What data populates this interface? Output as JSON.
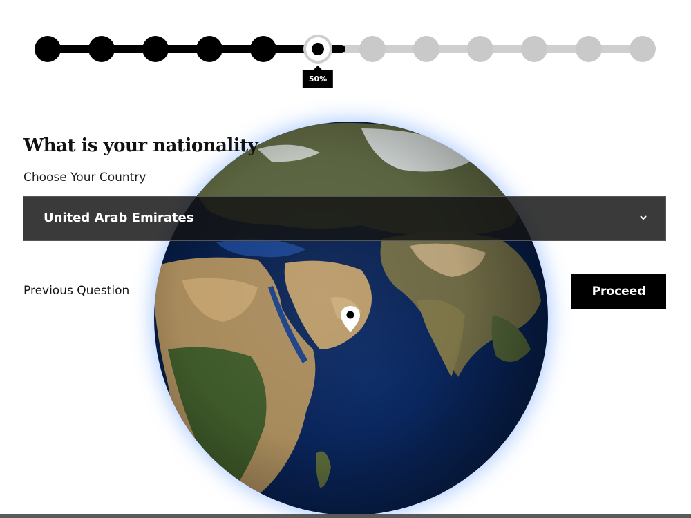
{
  "progress": {
    "percent_label": "50%",
    "percent": 50,
    "total_steps": 12,
    "completed_steps": 5,
    "current_step": 6,
    "colors": {
      "done": "#000000",
      "pending": "#c9c9c9",
      "badge": "#000000"
    }
  },
  "question": {
    "title": "What is your nationality",
    "subtitle": "Choose Your Country"
  },
  "country_select": {
    "selected_value": "United Arab Emirates",
    "icon": "chevron-down-icon"
  },
  "navigation": {
    "previous_label": "Previous Question",
    "proceed_label": "Proceed"
  },
  "globe": {
    "icon": "map-pin-icon",
    "pin_color": "#ffffff"
  }
}
